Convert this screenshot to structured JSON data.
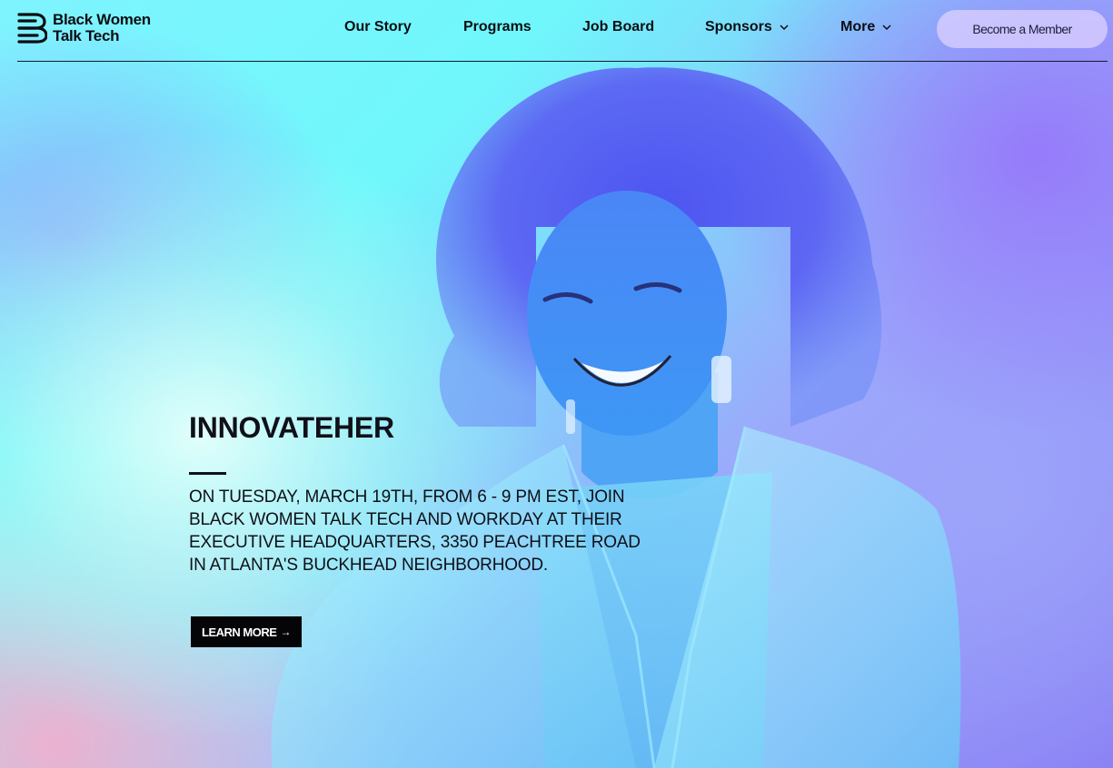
{
  "brand": {
    "line1": "Black Women",
    "line2": "Talk Tech"
  },
  "nav": {
    "items": [
      {
        "label": "Our Story"
      },
      {
        "label": "Programs"
      },
      {
        "label": "Job Board"
      },
      {
        "label": "Sponsors",
        "has_dropdown": true
      },
      {
        "label": "More",
        "has_dropdown": true
      }
    ],
    "cta_label": "Become a Member"
  },
  "hero": {
    "title": "INNOVATEHER",
    "body": "ON TUESDAY, MARCH 19TH, FROM 6 - 9 PM EST, JOIN BLACK WOMEN TALK TECH AND WORKDAY AT THEIR EXECUTIVE HEADQUARTERS, 3350 PEACHTREE ROAD IN ATLANTA'S BUCKHEAD NEIGHBORHOOD.",
    "button_label": "LEARN MORE",
    "button_icon": "arrow-right-icon"
  },
  "colors": {
    "cyan": "#6ff7fb",
    "violet": "#8a7ff5",
    "pink": "#ffaac8",
    "portrait_blue": "#3b6df2",
    "button_bg": "#050508",
    "cta_bg": "#d7cdff"
  }
}
